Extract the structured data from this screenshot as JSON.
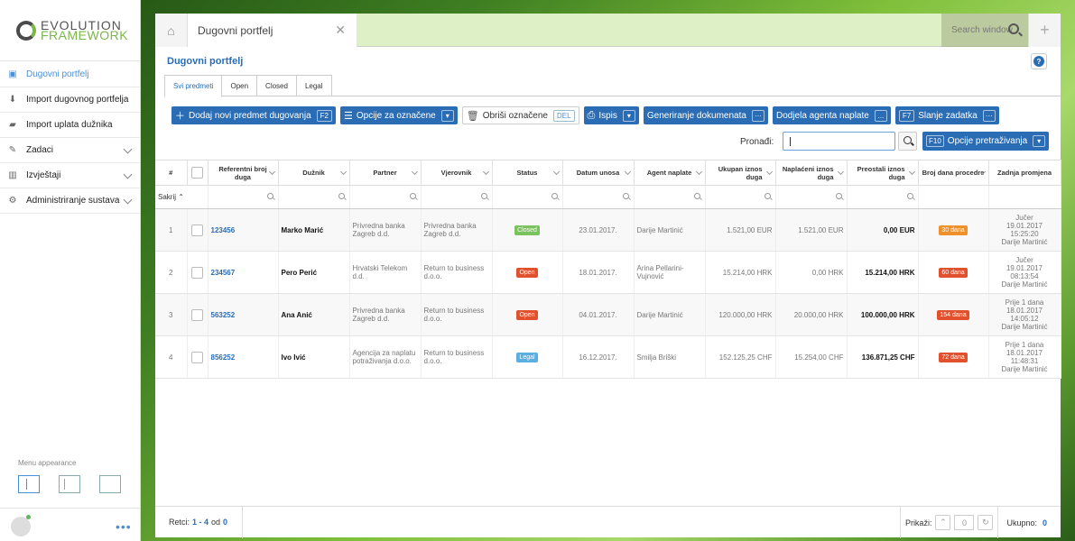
{
  "brand": {
    "line1": "EVOLUTION",
    "line2": "FRAMEWORK"
  },
  "sidebar": {
    "items": [
      {
        "label": "Dugovni portfelj",
        "icon": "portfolio-icon",
        "active": true
      },
      {
        "label": "Import dugovnog portfelja",
        "icon": "download-icon"
      },
      {
        "label": "Import uplata dužnika",
        "icon": "briefcase-icon"
      },
      {
        "label": "Zadaci",
        "icon": "pencil-icon"
      },
      {
        "label": "Izvještaji",
        "icon": "bar-chart-icon"
      },
      {
        "label": "Administriranje sustava",
        "icon": "gear-icon"
      }
    ],
    "menu_appearance": "Menu appearance"
  },
  "tabs": {
    "active": "Dugovni portfelj",
    "search_placeholder": "Search window"
  },
  "page": {
    "title": "Dugovni portfelj"
  },
  "subtabs": [
    "Svi predmeti",
    "Open",
    "Closed",
    "Legal"
  ],
  "toolbar": {
    "add": "Dodaj novi predmet dugovanja",
    "add_key": "F2",
    "options": "Opcije za označene",
    "delete": "Obriši označene",
    "delete_key": "DEL",
    "print": "Ispis",
    "generate": "Generiranje dokumenata",
    "assign": "Dodjela agenta naplate",
    "assign_key": "...",
    "send": "Slanje zadatka",
    "send_key": "F7"
  },
  "search": {
    "label": "Pronađi:",
    "options": "Opcije pretraživanja",
    "options_key": "F10"
  },
  "table": {
    "headers": [
      "#",
      "",
      "Referentni broj duga",
      "Dužnik",
      "Partner",
      "Vjerovnik",
      "Status",
      "Datum unosa",
      "Agent naplate",
      "Ukupan iznos duga",
      "Naplaćeni iznos duga",
      "Preostali iznos duga",
      "Broj dana procedre",
      "Zadnja promjena"
    ],
    "hide_label": "Sakrij",
    "rows": [
      {
        "n": "1",
        "ref": "123456",
        "debtor": "Marko Marić",
        "partner": "Privredna banka Zagreb d.d.",
        "creditor": "Privredna banka Zagreb d.d.",
        "status": "Closed",
        "date": "23.01.2017.",
        "agent": "Darije Martinić",
        "total": "1.521,00 EUR",
        "paid": "1.521,00 EUR",
        "remaining": "0,00 EUR",
        "days": "30 dana",
        "change": [
          "Jučer",
          "19.01.2017",
          "15:25:20",
          "Darije Martinić"
        ]
      },
      {
        "n": "2",
        "ref": "234567",
        "debtor": "Pero Perić",
        "partner": "Hrvatski Telekom d.d.",
        "creditor": "Return to business d.o.o.",
        "status": "Open",
        "date": "18.01.2017.",
        "agent": "Arina Pellarini-Vujnović",
        "total": "15.214,00 HRK",
        "paid": "0,00 HRK",
        "remaining": "15.214,00 HRK",
        "days": "60 dana",
        "change": [
          "Jučer",
          "19.01.2017",
          "08:13:54",
          "Darije Martinić"
        ]
      },
      {
        "n": "3",
        "ref": "563252",
        "debtor": "Ana Anić",
        "partner": "Privredna banka Zagreb d.d.",
        "creditor": "Return to business d.o.o.",
        "status": "Open",
        "date": "04.01.2017.",
        "agent": "Darije Martinić",
        "total": "120.000,00 HRK",
        "paid": "20.000,00 HRK",
        "remaining": "100.000,00 HRK",
        "days": "154 dana",
        "change": [
          "Prije 1 dana",
          "18.01.2017",
          "14:05:12",
          "Darije Martinić"
        ]
      },
      {
        "n": "4",
        "ref": "856252",
        "debtor": "Ivo Ivić",
        "partner": "Agencija za naplatu potraživanja d.o.o.",
        "creditor": "Return to business d.o.o.",
        "status": "Legal",
        "date": "16.12.2017.",
        "agent": "Smilja Briški",
        "total": "152.125,25 CHF",
        "paid": "15.254,00 CHF",
        "remaining": "136.871,25 CHF",
        "days": "72 dana",
        "change": [
          "Prije 1 dana",
          "18.01.2017",
          "11:48:31",
          "Darije Martinić"
        ]
      }
    ]
  },
  "footer": {
    "rows_label": "Retci:",
    "range": "1 - 4",
    "of": "od",
    "of_count": "0",
    "show_label": "Prikaži:",
    "page": "0",
    "total_label": "Ukupno:",
    "total": "0"
  }
}
